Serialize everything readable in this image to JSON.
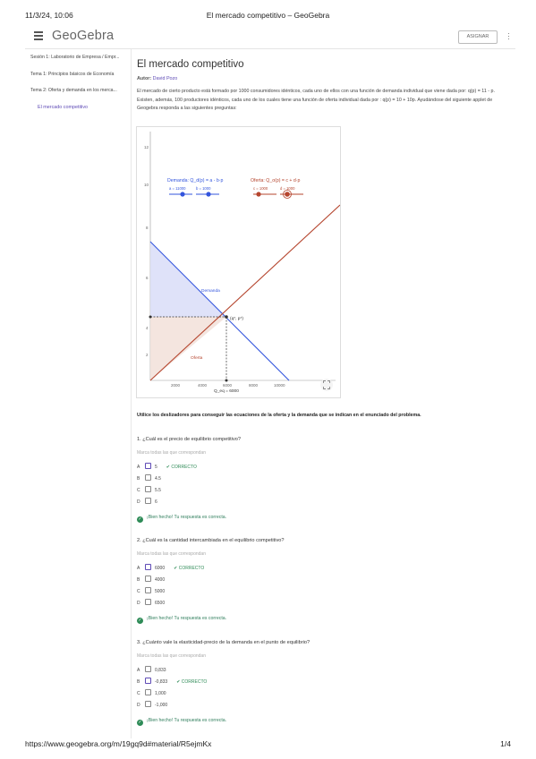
{
  "print_header": {
    "datetime": "11/3/24, 10:06",
    "page_title": "El mercado competitivo – GeoGebra"
  },
  "topbar": {
    "logo": "GeoGebra",
    "assign_label": "ASIGNAR"
  },
  "sidebar": {
    "items": [
      "Sesión 1: Laboratorio de Empresa / Empr...",
      "Tema 1: Principios básicos de Economía",
      "Tema 2: Oferta y demanda en los merca..."
    ],
    "active_item": "El mercado competitivo"
  },
  "main": {
    "title": "El mercado competitivo",
    "author_label": "Autor:",
    "author_name": "David Pozo",
    "description": "El mercado de cierto producto está formado por 1000 consumidores idénticos, cada uno de ellos con una función de demanda individual que viene dada por: q(p) = 11 - p. Existen, además, 100 productores idénticos, cada uno de los cuales tiene una función de oferta individual dada por : q(p) = 10 + 10p. Ayudándose del siguiente applet de Geogebra responda a las siguientes preguntas:",
    "instruction": "Utilice los deslizadores para conseguir las ecuaciones de la oferta y la demanda que se indican en el enunciado del problema."
  },
  "applet": {
    "demand_label": "Demanda: Q_d(p) = a - b·p",
    "supply_label": "Oferta: Q_o(p) = c + d·p",
    "slider_a": "a = 11000",
    "slider_b": "b = 1000",
    "slider_c": "c = 1000",
    "slider_d": "d = 1000",
    "curve_demand": "Demanda",
    "curve_supply": "Oferta",
    "eq_point": "(q*, p*)",
    "q_axis_label": "Q_eq = 6000",
    "y_ticks": [
      "12",
      "10",
      "8",
      "6",
      "4",
      "2"
    ],
    "x_ticks": [
      "2000",
      "4000",
      "6000",
      "8000",
      "10000"
    ],
    "demand_color": "#3355dd",
    "supply_color": "#b5452e"
  },
  "questions": [
    {
      "text": "1. ¿Cuál es el precio de equilibrio competitivo?",
      "hint": "Marca todas las que correspondan",
      "options": [
        {
          "letter": "A",
          "text": "5",
          "selected": true,
          "status": "CORRECTO"
        },
        {
          "letter": "B",
          "text": "4.5",
          "selected": false,
          "status": ""
        },
        {
          "letter": "C",
          "text": "5.5",
          "selected": false,
          "status": ""
        },
        {
          "letter": "D",
          "text": "6",
          "selected": false,
          "status": ""
        }
      ],
      "feedback": "¡Bien hecho! Tu respuesta es correcta."
    },
    {
      "text": "2. ¿Cuál es la cantidad intercambiada en el equilibrio competitivo?",
      "hint": "Marca todas las que correspondan",
      "options": [
        {
          "letter": "A",
          "text": "6000",
          "selected": true,
          "status": "CORRECTO"
        },
        {
          "letter": "B",
          "text": "4000",
          "selected": false,
          "status": ""
        },
        {
          "letter": "C",
          "text": "5000",
          "selected": false,
          "status": ""
        },
        {
          "letter": "D",
          "text": "6500",
          "selected": false,
          "status": ""
        }
      ],
      "feedback": "¡Bien hecho! Tu respuesta es correcta."
    },
    {
      "text": "3. ¿Cuánto vale la elasticidad-precio de la demanda en el punto de equilibrio?",
      "hint": "Marca todas las que correspondan",
      "options": [
        {
          "letter": "A",
          "text": "0,833",
          "selected": false,
          "status": ""
        },
        {
          "letter": "B",
          "text": "-0,833",
          "selected": true,
          "status": "CORRECTO"
        },
        {
          "letter": "C",
          "text": "1,000",
          "selected": false,
          "status": ""
        },
        {
          "letter": "D",
          "text": "-1,000",
          "selected": false,
          "status": ""
        }
      ],
      "feedback": "¡Bien hecho! Tu respuesta es correcta."
    }
  ],
  "footer": {
    "url": "https://www.geogebra.org/m/19gq9d#material/R5ejmKx",
    "page": "1/4"
  }
}
